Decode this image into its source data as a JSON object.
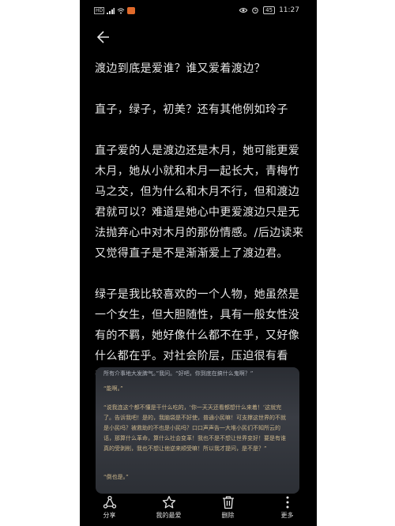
{
  "status_bar": {
    "left_icons": [
      "hd-icon",
      "signal-icon",
      "wifi-icon",
      "app-icon"
    ],
    "right_icons": [
      "eye-icon",
      "alarm-icon"
    ],
    "battery": "45",
    "time": "11:27"
  },
  "header": {
    "back_icon": "back-arrow-icon"
  },
  "post": {
    "paragraphs": [
      "渡边到底是爱谁？谁又爱着渡边？",
      "直子，绿子，初美？还有其他例如玲子",
      "直子爱的人是渡边还是木月，她可能更爱木月，她从小就和木月一起长大，青梅竹马之交，但为什么和木月不行，但和渡边君就可以？难道是她心中更爱渡边只是无法抛弃心中对木月的那份情感。/后边读来又觉得直子是不是渐渐爱上了渡边君。",
      "绿子是我比较喜欢的一个人物，她虽然是一个女生，但大胆随性，具有一般女性没有的不羁，她好像什么都不在乎，又好像什么都在乎。对社会阶层，压迫很有看法。有血有肉的女孩。"
    ]
  },
  "image": {
    "lines": [
      "所有介事地大发脾气。”我问。“好吧，你到底在搞什么鬼啊？”",
      "“能啊。”",
      "“说我连这个都不懂是干什么吃的，‘你一天天还看都想什么来着！’这就完了。告诉我吧！是的，我脑袋是不好使，普通小民嘛！可支撑这世界的不就是小民吗？被救助的不也是小民吗？口口声声告一大堆小民们不知所云的话，那算什么革命，算什么社会变革！我也不是不想让世界变好！要是有谁真的受剥削，我也不想让他逆来顺受嘛！所以我才提问，是不是？”",
      "“倒也是。”"
    ]
  },
  "bottom_bar": {
    "items": [
      {
        "label": "分享",
        "icon": "share-icon"
      },
      {
        "label": "我的最爱",
        "icon": "star-icon"
      },
      {
        "label": "删除",
        "icon": "trash-icon"
      },
      {
        "label": "更多",
        "icon": "more-icon"
      }
    ]
  },
  "colors": {
    "background": "#000000",
    "text": "#e6e6e6",
    "photo_text": "#c9b48a"
  }
}
